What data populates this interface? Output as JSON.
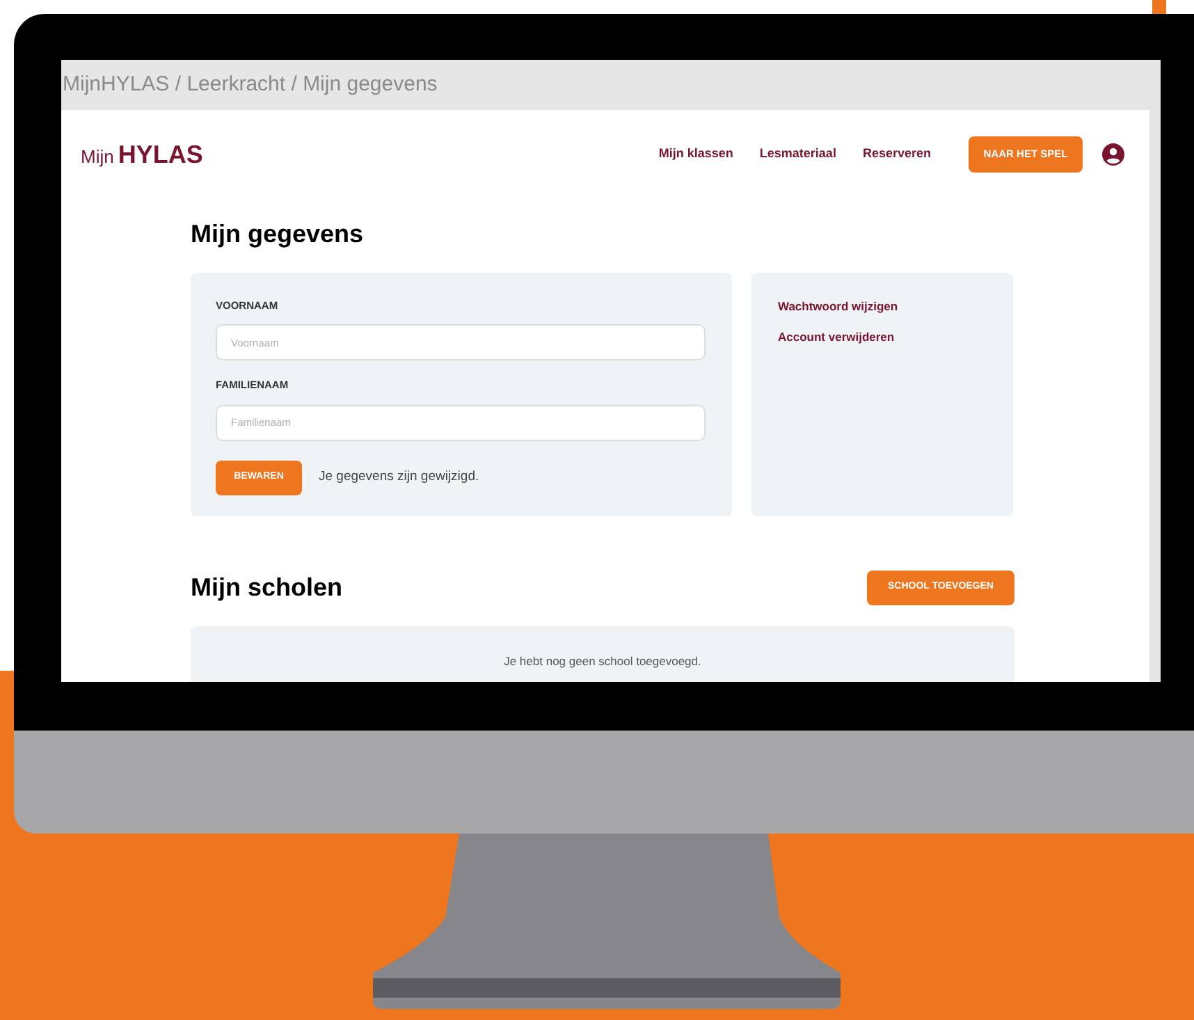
{
  "address_bar": {
    "path": "MijnHYLAS / Leerkracht / Mijn gegevens"
  },
  "header": {
    "logo_prefix": "Mijn",
    "logo_name": "HYLAS",
    "nav": [
      {
        "label": "Mijn klassen"
      },
      {
        "label": "Lesmateriaal"
      },
      {
        "label": "Reserveren"
      }
    ],
    "cta": "NAAR HET SPEL"
  },
  "profile": {
    "title": "Mijn gegevens",
    "fields": [
      {
        "label": "VOORNAAM",
        "placeholder": "Voornaam"
      },
      {
        "label": "FAMILIENAAM",
        "placeholder": "Familienaam"
      }
    ],
    "save_button": "BEWAREN",
    "status": "Je gegevens zijn gewijzigd.",
    "links": [
      {
        "label": "Wachtwoord wijzigen"
      },
      {
        "label": "Account verwijderen"
      }
    ]
  },
  "schools": {
    "title": "Mijn scholen",
    "add_button": "SCHOOL TOEVOEGEN",
    "empty": "Je hebt nog geen school toegevoegd."
  }
}
